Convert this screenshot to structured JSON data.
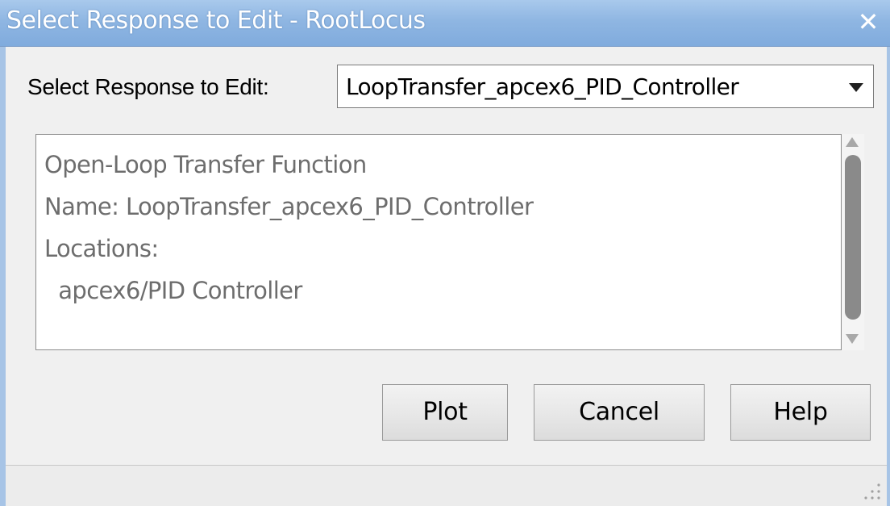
{
  "window": {
    "title": "Select Response to Edit - RootLocus",
    "close_glyph": "✕"
  },
  "select_row": {
    "label": "Select Response to Edit:",
    "selected_value": "LoopTransfer_apcex6_PID_Controller"
  },
  "details": {
    "lines": [
      "Open-Loop Transfer Function",
      "Name: LoopTransfer_apcex6_PID_Controller",
      "Locations:",
      "  apcex6/PID Controller"
    ]
  },
  "buttons": {
    "plot": "Plot",
    "cancel": "Cancel",
    "help": "Help"
  },
  "colors": {
    "titlebar_accent": "#8fb6e2",
    "detail_text": "#6d6d6d"
  },
  "icons": {
    "close": "close-icon",
    "dropdown": "chevron-down-icon",
    "scroll_up": "scroll-up-arrow-icon",
    "scroll_down": "scroll-down-arrow-icon",
    "resize": "resize-grip-icon"
  }
}
